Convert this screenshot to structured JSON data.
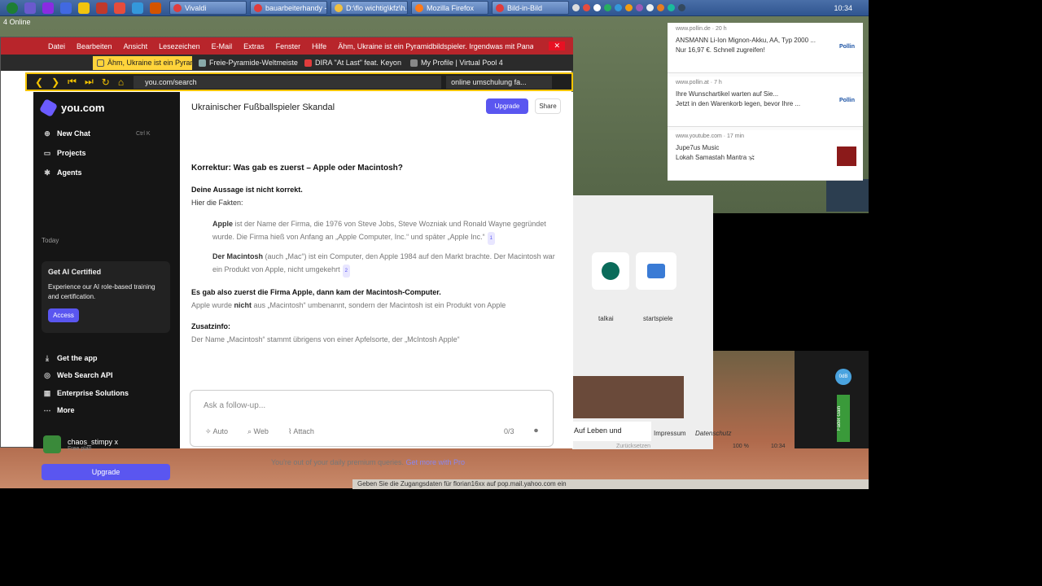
{
  "taskbar": {
    "tasks": [
      "Vivaldi",
      "bauarbeiterhandy - ...",
      "D:\\flo wichtig\\kfz\\h...",
      "Mozilla Firefox",
      "Bild-in-Bild"
    ],
    "clock": "10:34"
  },
  "desktop": {
    "online": "4 Online",
    "status": "Geben Sie die Zugangsdaten für florian16xx auf pop.mail.yahoo.com ein"
  },
  "mail": {
    "menu": [
      "Datei",
      "Bearbeiten",
      "Ansicht",
      "Lesezeichen",
      "E-Mail",
      "Extras",
      "Fenster",
      "Hilfe"
    ],
    "title": "Ähm, Ukraine ist ein Pyramidbildspieler. Irgendwas mit Panama, Pa..."
  },
  "tabs": [
    "Ähm, Ukraine ist ein Pyramid",
    "Freie-Pyramide-Weltmeisters",
    "DIRA \"At Last\" feat. Keyon Ha",
    "My Profile | Virtual Pool 4"
  ],
  "address": {
    "url": "you.com/search",
    "search": "online umschulung fa..."
  },
  "sidebar": {
    "brand": "you.com",
    "items": [
      {
        "label": "New Chat",
        "shortcut": "Ctrl K"
      },
      {
        "label": "Projects"
      },
      {
        "label": "Agents"
      }
    ],
    "today": "Today",
    "card": {
      "title": "Get AI Certified",
      "desc": "Experience our AI role-based training and certification.",
      "button": "Access"
    },
    "links": [
      "Get the app",
      "Web Search API",
      "Enterprise Solutions",
      "More"
    ],
    "user": {
      "name": "chaos_stimpy x",
      "plan": "Free plan"
    },
    "upgrade": "Upgrade"
  },
  "main": {
    "title": "Ukrainischer Fußballspieler Skandal",
    "upgrade": "Upgrade",
    "share": "Share",
    "heading": "Korrektur: Was gab es zuerst – Apple oder Macintosh?",
    "p1b": "Deine Aussage ist nicht korrekt.",
    "p1": "Hier die Fakten:",
    "li1b": "Apple",
    "li1": " ist der Name der Firma, die 1976 von Steve Jobs, Steve Wozniak und Ronald Wayne gegründet wurde. Die Firma hieß von Anfang an „Apple Computer, Inc.“ und später „Apple Inc.“",
    "li2b": "Der Macintosh",
    "li2": " (auch „Mac“) ist ein Computer, den Apple 1984 auf den Markt brachte. Der Macintosh war ein Produkt von Apple, nicht umgekehrt",
    "p2b": "Es gab also zuerst die Firma Apple, dann kam der Macintosh-Computer.",
    "p2a": "Apple wurde ",
    "p2n": "nicht",
    "p2c": " aus „Macintosh“ umbenannt, sondern der Macintosh ist ein Produkt von Apple",
    "zb": "Zusatzinfo:",
    "z": "Der Name „Macintosh“ stammt übrigens von einer Apfelsorte, der „McIntosh Apple“",
    "placeholder": "Ask a follow-up...",
    "auto": "Auto",
    "web": "Web",
    "attach": "Attach",
    "count": "0/3",
    "outof": "You're out of your daily premium queries.",
    "getmore": "Get more with Pro"
  },
  "notifications": [
    {
      "src": "www.pollin.de · 20 h",
      "t1": "ANSMANN Li-Ion Mignon-Akku, AA, Typ 2000 ...",
      "t2": "Nur 16,97 €. Schnell zugreifen!",
      "logo": "Pollin"
    },
    {
      "src": "www.pollin.at · 7 h",
      "t1": "Ihre Wunschartikel warten auf Sie...",
      "t2": "Jetzt in den Warenkorb legen, bevor Ihre ...",
      "logo": "Pollin"
    },
    {
      "src": "www.youtube.com · 17 min",
      "t1": "Jupe7us Music",
      "t2": "Lokah Samastah Mantra 🕉",
      "logo": ""
    }
  ],
  "rightpane": {
    "tiles": [
      "talkai",
      "startspiele"
    ],
    "text1": "Auf Leben und",
    "link1": "Impressum",
    "link2": "Datenschutz",
    "zoom": "100 %",
    "time": "10:34",
    "reset": "Zurücksetzen"
  },
  "mixer": {
    "gain": "0dB",
    "label": "Fader Gain"
  }
}
